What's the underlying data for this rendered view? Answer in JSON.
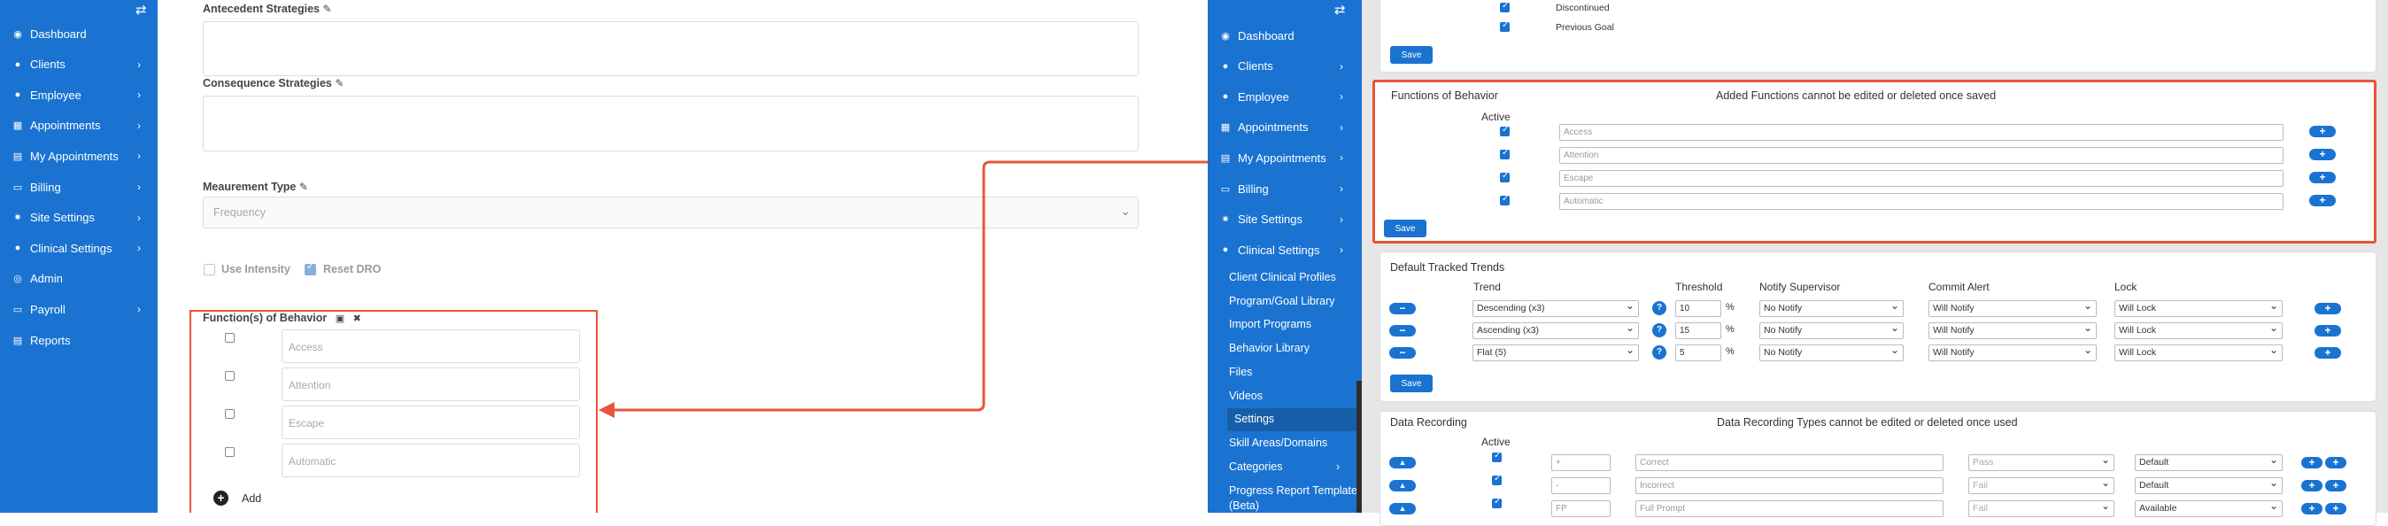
{
  "left_panel": {
    "nav": [
      {
        "label": "Dashboard",
        "icon": "dashboard-icon",
        "glyph": "◉",
        "chevron": false
      },
      {
        "label": "Clients",
        "icon": "user-icon",
        "glyph": "●",
        "chevron": true
      },
      {
        "label": "Employee",
        "icon": "users-icon",
        "glyph": "●",
        "chevron": true
      },
      {
        "label": "Appointments",
        "icon": "calendar-icon",
        "glyph": "▦",
        "chevron": true
      },
      {
        "label": "My Appointments",
        "icon": "calendar-icon",
        "glyph": "▤",
        "chevron": true
      },
      {
        "label": "Billing",
        "icon": "billing-icon",
        "glyph": "▭",
        "chevron": true
      },
      {
        "label": "Site Settings",
        "icon": "gear-icon",
        "glyph": "✷",
        "chevron": true
      },
      {
        "label": "Clinical Settings",
        "icon": "user-icon",
        "glyph": "●",
        "chevron": true
      },
      {
        "label": "Admin",
        "icon": "admin-icon",
        "glyph": "◎",
        "chevron": false
      },
      {
        "label": "Payroll",
        "icon": "payroll-icon",
        "glyph": "▭",
        "chevron": true
      },
      {
        "label": "Reports",
        "icon": "reports-icon",
        "glyph": "▤",
        "chevron": false
      }
    ],
    "toggle_glyph": "⇄",
    "antecedent_label": "Antecedent Strategies",
    "consequence_label": "Consequence Strategies",
    "measurement_label": "Meaurement Type",
    "measurement_value": "Frequency",
    "use_intensity": "Use Intensity",
    "reset_dro": "Reset DRO",
    "functions_label": "Function(s) of Behavior",
    "functions": [
      "Access",
      "Attention",
      "Escape",
      "Automatic"
    ],
    "add_label": "Add",
    "pencil": "✎",
    "close_glyph": "✖",
    "save_glyph": "▣",
    "plus_circle": "+"
  },
  "right_panel": {
    "nav": [
      {
        "label": "Dashboard",
        "icon": "dashboard-icon",
        "glyph": "◉",
        "chevron": false
      },
      {
        "label": "Clients",
        "icon": "user-icon",
        "glyph": "●",
        "chevron": true
      },
      {
        "label": "Employee",
        "icon": "users-icon",
        "glyph": "●",
        "chevron": true
      },
      {
        "label": "Appointments",
        "icon": "calendar-icon",
        "glyph": "▦",
        "chevron": true
      },
      {
        "label": "My Appointments",
        "icon": "calendar-icon",
        "glyph": "▤",
        "chevron": true
      },
      {
        "label": "Billing",
        "icon": "billing-icon",
        "glyph": "▭",
        "chevron": true
      },
      {
        "label": "Site Settings",
        "icon": "gear-icon",
        "glyph": "✷",
        "chevron": true
      },
      {
        "label": "Clinical Settings",
        "icon": "user-icon",
        "glyph": "●",
        "chevron": true
      }
    ],
    "sub_nav": [
      "Client Clinical Profiles",
      "Program/Goal Library",
      "Import Programs",
      "Behavior Library",
      "Files",
      "Videos",
      "Settings",
      "Skill Areas/Domains",
      "Categories",
      "Progress Report Template",
      "(Beta)"
    ],
    "sub_active": "Settings",
    "toggle_glyph": "⇄",
    "top_checks": [
      "Discontinued",
      "Previous Goal"
    ],
    "save": "Save",
    "functions_title": "Functions of Behavior",
    "functions_note": "Added Functions cannot be edited or deleted once saved",
    "active_label": "Active",
    "functions": [
      "Access",
      "Attention",
      "Escape",
      "Automatic"
    ],
    "trends_title": "Default Tracked Trends",
    "trend_headers": {
      "trend": "Trend",
      "threshold": "Threshold",
      "notify": "Notify Supervisor",
      "commit": "Commit Alert",
      "lock": "Lock"
    },
    "trends": [
      {
        "trend": "Descending (x3)",
        "threshold": "10",
        "notify": "No Notify",
        "commit": "Will Notify",
        "lock": "Will Lock"
      },
      {
        "trend": "Ascending (x3)",
        "threshold": "15",
        "notify": "No Notify",
        "commit": "Will Notify",
        "lock": "Will Lock"
      },
      {
        "trend": "Flat (5)",
        "threshold": "5",
        "notify": "No Notify",
        "commit": "Will Notify",
        "lock": "Will Lock"
      }
    ],
    "percent": "%",
    "help_glyph": "?",
    "minus_glyph": "−",
    "plus_glyph": "+",
    "up_glyph": "▲",
    "recording_title": "Data Recording",
    "recording_note": "Data Recording Types cannot be edited or deleted once used",
    "recording": [
      {
        "symbol": "+",
        "name": "Correct",
        "result": "Pass",
        "mode": "Default"
      },
      {
        "symbol": "-",
        "name": "Incorrect",
        "result": "Fail",
        "mode": "Default"
      },
      {
        "symbol": "FP",
        "name": "Full Prompt",
        "result": "Fail",
        "mode": "Available"
      }
    ]
  },
  "colors": {
    "brand": "#1a73d1",
    "highlight": "#e8553a"
  }
}
